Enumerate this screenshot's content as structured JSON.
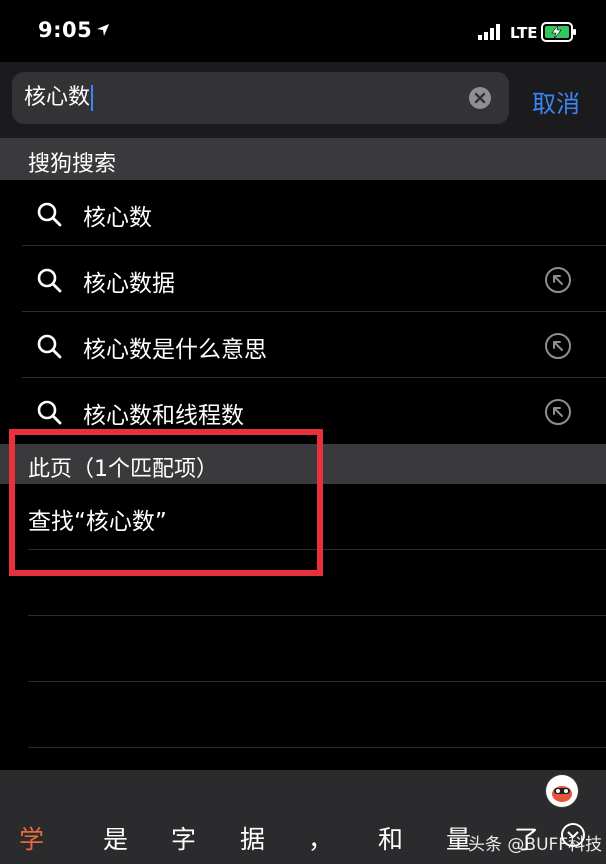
{
  "status_bar": {
    "time": "9:05",
    "network": "LTE"
  },
  "search": {
    "query": "核心数",
    "cancel_label": "取消"
  },
  "sections": {
    "search_engine": "搜狗搜索",
    "this_page": "此页（1个匹配项）"
  },
  "suggestions": [
    {
      "label": "核心数",
      "has_fill_arrow": false
    },
    {
      "label": "核心数据",
      "has_fill_arrow": true
    },
    {
      "label": "核心数是什么意思",
      "has_fill_arrow": true
    },
    {
      "label": "核心数和线程数",
      "has_fill_arrow": true
    }
  ],
  "find_on_page": {
    "label": "查找“核心数”"
  },
  "keyboard": {
    "candidates": [
      "学",
      "是",
      "字",
      "据",
      "，",
      "和",
      "量",
      "了"
    ]
  },
  "watermark": "头条 @BUFF科技",
  "colors": {
    "accent": "#3a86f4",
    "candidate_highlight": "#e86a3a",
    "annotation_box": "#e8313c"
  }
}
